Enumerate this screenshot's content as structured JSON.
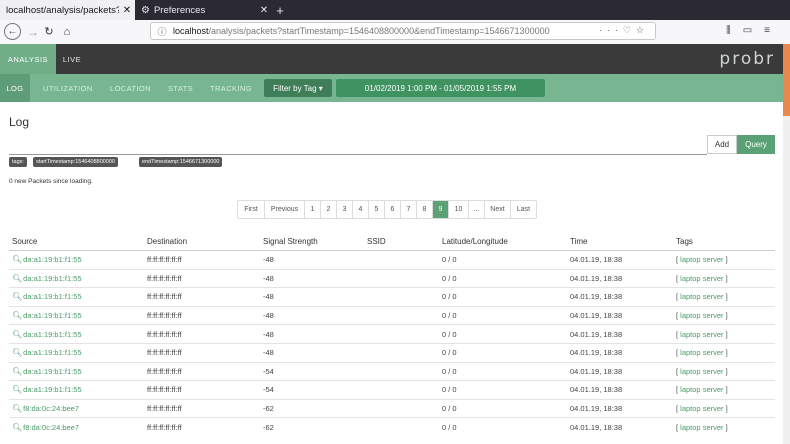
{
  "browser": {
    "tabs": [
      {
        "title": "localhost/analysis/packets?",
        "active": true
      },
      {
        "title": "Preferences",
        "active": false
      }
    ],
    "url_host": "localhost",
    "url_rest": "/analysis/packets?startTimestamp=1546408800000&endTimestamp=1546671300000"
  },
  "app": {
    "top_tabs": [
      "ANALYSIS",
      "LIVE"
    ],
    "logo": "probr",
    "sub_nav": [
      "LOG",
      "UTILIZATION",
      "LOCATION",
      "STATS",
      "TRACKING"
    ],
    "filter_label": "Filter by Tag ▾",
    "date_range": "01/02/2019 1:00 PM - 01/05/2019 1:55 PM"
  },
  "page": {
    "title": "Log",
    "add_label": "Add",
    "query_label": "Query",
    "tags": [
      "tags:",
      "startTimestamp:1546408800000",
      "endTimestamp:1546671300000"
    ],
    "new_packets": "0 new Packets since loading."
  },
  "pagination": [
    "First",
    "Previous",
    "1",
    "2",
    "3",
    "4",
    "5",
    "6",
    "7",
    "8",
    "9",
    "10",
    "...",
    "Next",
    "Last"
  ],
  "pagination_active": "9",
  "table": {
    "headers": [
      "Source",
      "Destination",
      "Signal Strength",
      "SSID",
      "Latitude/Longitude",
      "Time",
      "Tags"
    ],
    "rows": [
      {
        "source": "da:a1:19:b1:f1:55",
        "destination": "ff:ff:ff:ff:ff:ff",
        "signal": "-48",
        "ssid": "",
        "latlon": "0 / 0",
        "time": "04.01.19, 18:38",
        "tag": "laptop server"
      },
      {
        "source": "da:a1:19:b1:f1:55",
        "destination": "ff:ff:ff:ff:ff:ff",
        "signal": "-48",
        "ssid": "",
        "latlon": "0 / 0",
        "time": "04.01.19, 18:38",
        "tag": "laptop server"
      },
      {
        "source": "da:a1:19:b1:f1:55",
        "destination": "ff:ff:ff:ff:ff:ff",
        "signal": "-48",
        "ssid": "",
        "latlon": "0 / 0",
        "time": "04.01.19, 18:38",
        "tag": "laptop server"
      },
      {
        "source": "da:a1:19:b1:f1:55",
        "destination": "ff:ff:ff:ff:ff:ff",
        "signal": "-48",
        "ssid": "",
        "latlon": "0 / 0",
        "time": "04.01.19, 18:38",
        "tag": "laptop server"
      },
      {
        "source": "da:a1:19:b1:f1:55",
        "destination": "ff:ff:ff:ff:ff:ff",
        "signal": "-48",
        "ssid": "",
        "latlon": "0 / 0",
        "time": "04.01.19, 18:38",
        "tag": "laptop server"
      },
      {
        "source": "da:a1:19:b1:f1:55",
        "destination": "ff:ff:ff:ff:ff:ff",
        "signal": "-48",
        "ssid": "",
        "latlon": "0 / 0",
        "time": "04.01.19, 18:38",
        "tag": "laptop server"
      },
      {
        "source": "da:a1:19:b1:f1:55",
        "destination": "ff:ff:ff:ff:ff:ff",
        "signal": "-54",
        "ssid": "",
        "latlon": "0 / 0",
        "time": "04.01.19, 18:38",
        "tag": "laptop server"
      },
      {
        "source": "da:a1:19:b1:f1:55",
        "destination": "ff:ff:ff:ff:ff:ff",
        "signal": "-54",
        "ssid": "",
        "latlon": "0 / 0",
        "time": "04.01.19, 18:38",
        "tag": "laptop server"
      },
      {
        "source": "f8:da:0c:24:bee7",
        "destination": "ff:ff:ff:ff:ff:ff",
        "signal": "-62",
        "ssid": "",
        "latlon": "0 / 0",
        "time": "04.01.19, 18:38",
        "tag": "laptop server"
      },
      {
        "source": "f8:da:0c:24:bee7",
        "destination": "ff:ff:ff:ff:ff:ff",
        "signal": "-62",
        "ssid": "",
        "latlon": "0 / 0",
        "time": "04.01.19, 18:38",
        "tag": "laptop server"
      }
    ]
  }
}
